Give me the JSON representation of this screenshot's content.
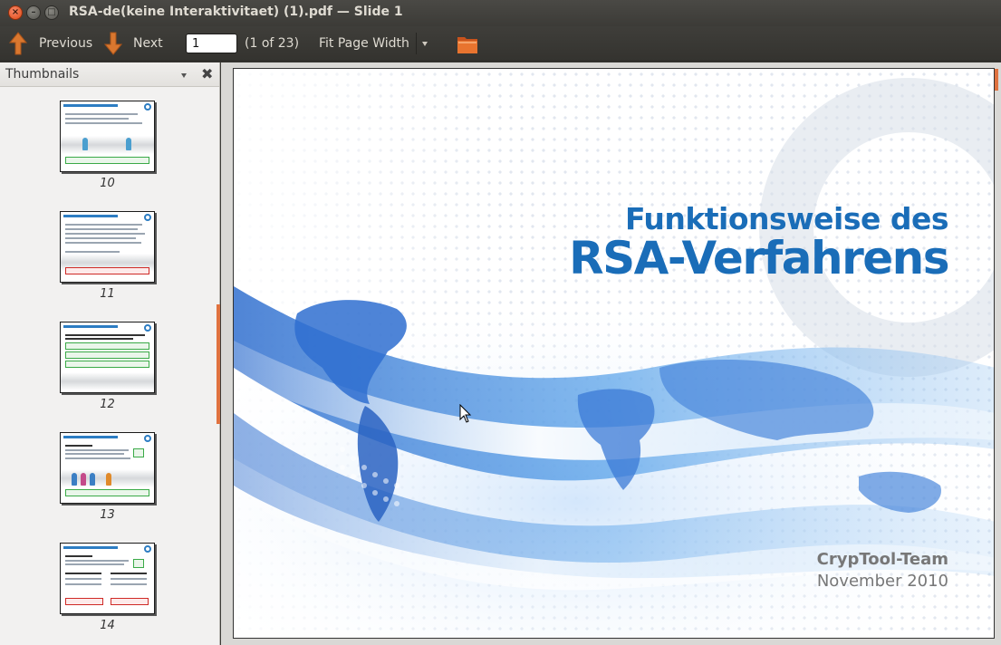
{
  "window": {
    "title": "RSA-de(keine Interaktivitaet) (1).pdf — Slide 1",
    "controls": {
      "close": "×",
      "minimize": "–",
      "maximize": "□"
    }
  },
  "toolbar": {
    "previous_label": "Previous",
    "next_label": "Next",
    "page_value": "1",
    "page_count": "(1 of 23)",
    "zoom_label": "Fit Page Width",
    "accent": "#e07b39"
  },
  "sidebar": {
    "title": "Thumbnails",
    "close_glyph": "✖",
    "thumbnails": [
      {
        "label": "10"
      },
      {
        "label": "11"
      },
      {
        "label": "12"
      },
      {
        "label": "13"
      },
      {
        "label": "14"
      }
    ]
  },
  "slide": {
    "title_line1": "Funktionsweise des",
    "title_line2": "RSA-Verfahrens",
    "author": "CrypTool-Team",
    "date": "November 2010",
    "title_color": "#1a6db8"
  }
}
